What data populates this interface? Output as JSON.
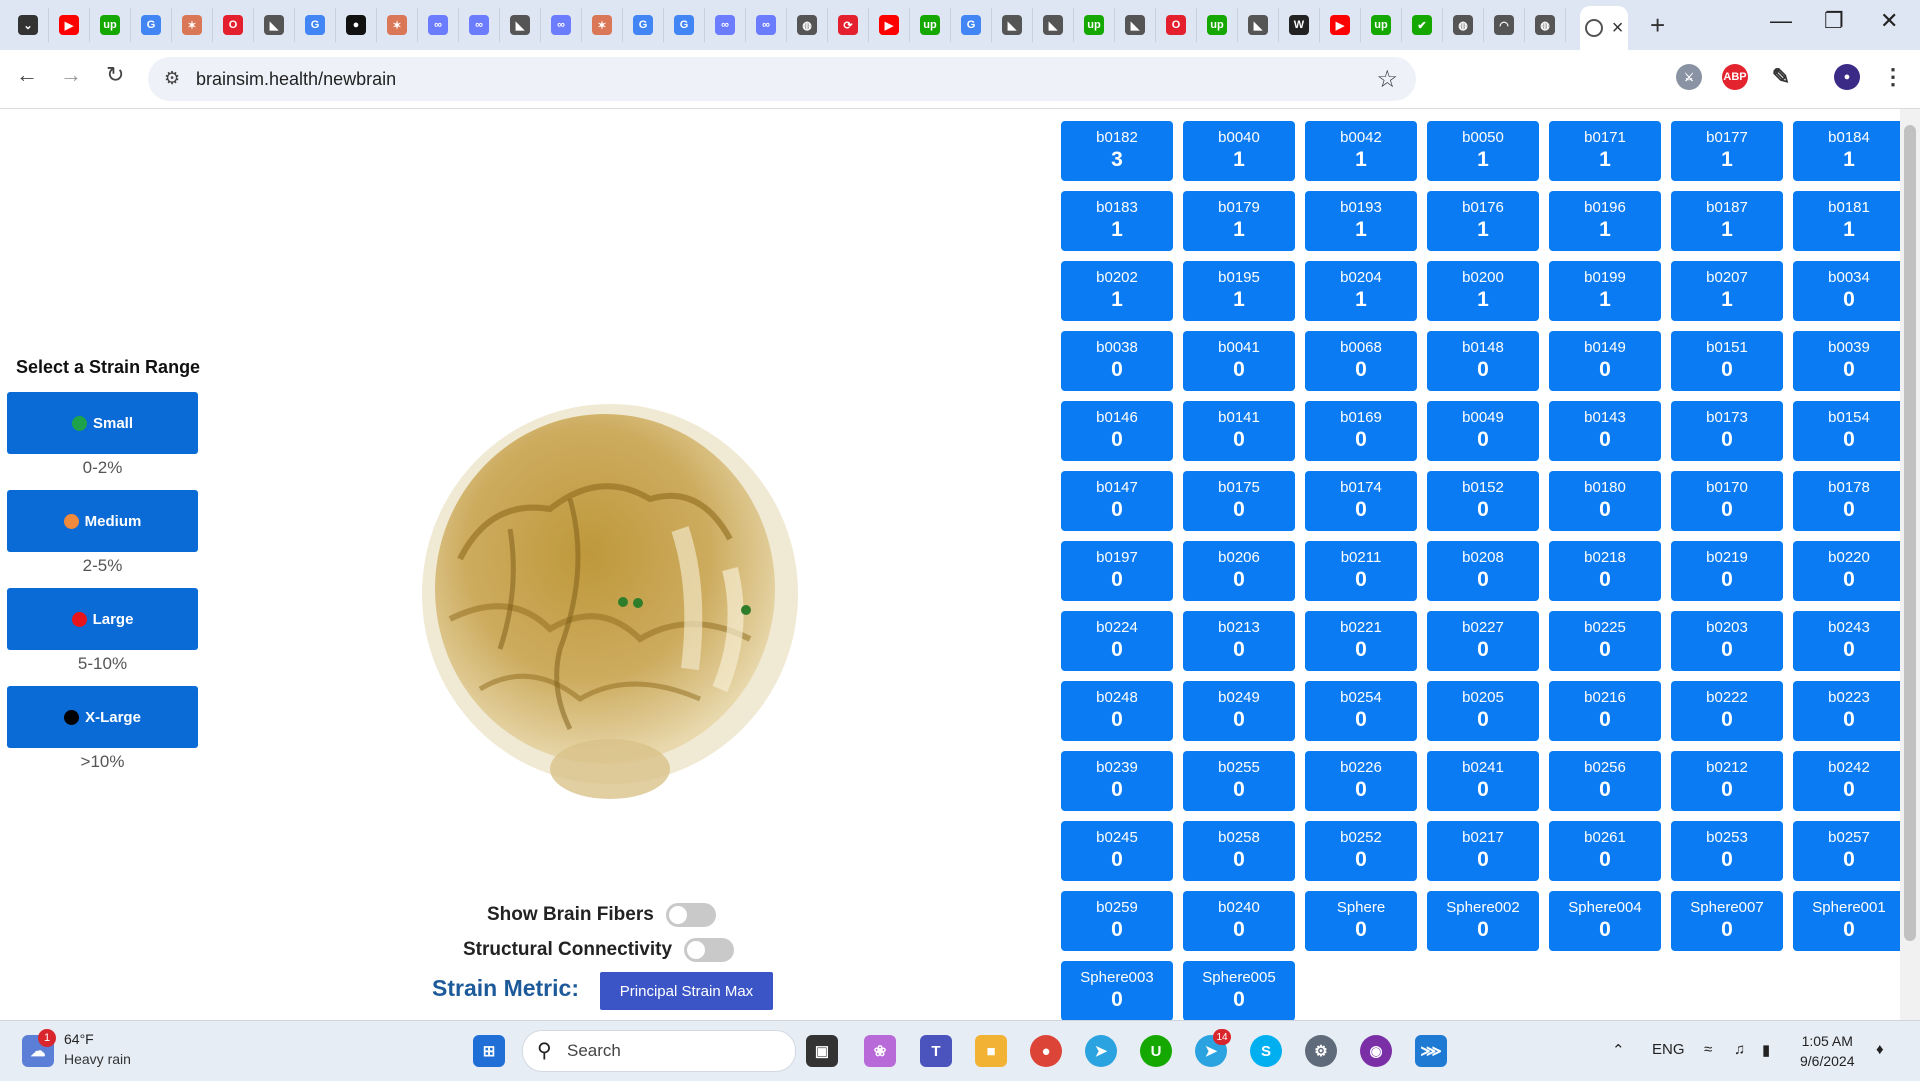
{
  "browser": {
    "url": "brainsim.health/newbrain",
    "tab_icons": [
      "chevron-down",
      "youtube",
      "upwork",
      "google",
      "claude",
      "opera",
      "cursor",
      "google",
      "github",
      "claude",
      "copilot",
      "copilot",
      "cursor",
      "copilot",
      "claude",
      "google",
      "google",
      "copilot",
      "copilot",
      "globe",
      "sync",
      "youtube",
      "upwork",
      "google",
      "cursor",
      "cursor",
      "upwork",
      "cursor",
      "opera",
      "upwork",
      "cursor",
      "wikipedia",
      "youtube",
      "upwork",
      "check",
      "globe",
      "chat",
      "globe"
    ],
    "active_tab_close": "×",
    "new_tab": "+"
  },
  "sidebar": {
    "title": "Select a Strain Range",
    "ranges": [
      {
        "label": "Small",
        "range": "0-2%",
        "color": "#1fa34a"
      },
      {
        "label": "Medium",
        "range": "2-5%",
        "color": "#f08a3c"
      },
      {
        "label": "Large",
        "range": "5-10%",
        "color": "#e8141b"
      },
      {
        "label": "X-Large",
        "range": ">10%",
        "color": "#000000"
      }
    ]
  },
  "controls": {
    "show_fibers": "Show Brain Fibers",
    "structural": "Structural Connectivity",
    "metric_label": "Strain Metric:",
    "metric_button": "Principal Strain Max"
  },
  "regions": [
    {
      "name": "b0182",
      "count": "3"
    },
    {
      "name": "b0040",
      "count": "1"
    },
    {
      "name": "b0042",
      "count": "1"
    },
    {
      "name": "b0050",
      "count": "1"
    },
    {
      "name": "b0171",
      "count": "1"
    },
    {
      "name": "b0177",
      "count": "1"
    },
    {
      "name": "b0184",
      "count": "1"
    },
    {
      "name": "b0183",
      "count": "1"
    },
    {
      "name": "b0179",
      "count": "1"
    },
    {
      "name": "b0193",
      "count": "1"
    },
    {
      "name": "b0176",
      "count": "1"
    },
    {
      "name": "b0196",
      "count": "1"
    },
    {
      "name": "b0187",
      "count": "1"
    },
    {
      "name": "b0181",
      "count": "1"
    },
    {
      "name": "b0202",
      "count": "1"
    },
    {
      "name": "b0195",
      "count": "1"
    },
    {
      "name": "b0204",
      "count": "1"
    },
    {
      "name": "b0200",
      "count": "1"
    },
    {
      "name": "b0199",
      "count": "1"
    },
    {
      "name": "b0207",
      "count": "1"
    },
    {
      "name": "b0034",
      "count": "0"
    },
    {
      "name": "b0038",
      "count": "0"
    },
    {
      "name": "b0041",
      "count": "0"
    },
    {
      "name": "b0068",
      "count": "0"
    },
    {
      "name": "b0148",
      "count": "0"
    },
    {
      "name": "b0149",
      "count": "0"
    },
    {
      "name": "b0151",
      "count": "0"
    },
    {
      "name": "b0039",
      "count": "0"
    },
    {
      "name": "b0146",
      "count": "0"
    },
    {
      "name": "b0141",
      "count": "0"
    },
    {
      "name": "b0169",
      "count": "0"
    },
    {
      "name": "b0049",
      "count": "0"
    },
    {
      "name": "b0143",
      "count": "0"
    },
    {
      "name": "b0173",
      "count": "0"
    },
    {
      "name": "b0154",
      "count": "0"
    },
    {
      "name": "b0147",
      "count": "0"
    },
    {
      "name": "b0175",
      "count": "0"
    },
    {
      "name": "b0174",
      "count": "0"
    },
    {
      "name": "b0152",
      "count": "0"
    },
    {
      "name": "b0180",
      "count": "0"
    },
    {
      "name": "b0170",
      "count": "0"
    },
    {
      "name": "b0178",
      "count": "0"
    },
    {
      "name": "b0197",
      "count": "0"
    },
    {
      "name": "b0206",
      "count": "0"
    },
    {
      "name": "b0211",
      "count": "0"
    },
    {
      "name": "b0208",
      "count": "0"
    },
    {
      "name": "b0218",
      "count": "0"
    },
    {
      "name": "b0219",
      "count": "0"
    },
    {
      "name": "b0220",
      "count": "0"
    },
    {
      "name": "b0224",
      "count": "0"
    },
    {
      "name": "b0213",
      "count": "0"
    },
    {
      "name": "b0221",
      "count": "0"
    },
    {
      "name": "b0227",
      "count": "0"
    },
    {
      "name": "b0225",
      "count": "0"
    },
    {
      "name": "b0203",
      "count": "0"
    },
    {
      "name": "b0243",
      "count": "0"
    },
    {
      "name": "b0248",
      "count": "0"
    },
    {
      "name": "b0249",
      "count": "0"
    },
    {
      "name": "b0254",
      "count": "0"
    },
    {
      "name": "b0205",
      "count": "0"
    },
    {
      "name": "b0216",
      "count": "0"
    },
    {
      "name": "b0222",
      "count": "0"
    },
    {
      "name": "b0223",
      "count": "0"
    },
    {
      "name": "b0239",
      "count": "0"
    },
    {
      "name": "b0255",
      "count": "0"
    },
    {
      "name": "b0226",
      "count": "0"
    },
    {
      "name": "b0241",
      "count": "0"
    },
    {
      "name": "b0256",
      "count": "0"
    },
    {
      "name": "b0212",
      "count": "0"
    },
    {
      "name": "b0242",
      "count": "0"
    },
    {
      "name": "b0245",
      "count": "0"
    },
    {
      "name": "b0258",
      "count": "0"
    },
    {
      "name": "b0252",
      "count": "0"
    },
    {
      "name": "b0217",
      "count": "0"
    },
    {
      "name": "b0261",
      "count": "0"
    },
    {
      "name": "b0253",
      "count": "0"
    },
    {
      "name": "b0257",
      "count": "0"
    },
    {
      "name": "b0259",
      "count": "0"
    },
    {
      "name": "b0240",
      "count": "0"
    },
    {
      "name": "Sphere",
      "count": "0"
    },
    {
      "name": "Sphere002",
      "count": "0"
    },
    {
      "name": "Sphere004",
      "count": "0"
    },
    {
      "name": "Sphere007",
      "count": "0"
    },
    {
      "name": "Sphere001",
      "count": "0"
    },
    {
      "name": "Sphere003",
      "count": "0"
    },
    {
      "name": "Sphere005",
      "count": "0"
    }
  ],
  "taskbar": {
    "weather_temp": "64°F",
    "weather_desc": "Heavy rain",
    "weather_badge": "1",
    "search": "Search",
    "telegram_badge": "14",
    "language": "ENG",
    "time": "1:05 AM",
    "date": "9/6/2024"
  }
}
